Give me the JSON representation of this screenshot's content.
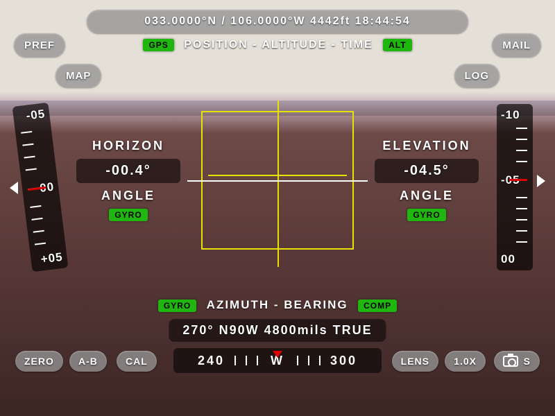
{
  "top": {
    "status": "033.0000°N / 106.0000°W   4442ft   18:44:54",
    "subtitle": "POSITION - ALTITUDE - TIME",
    "gps_chip": "GPS",
    "alt_chip": "ALT"
  },
  "buttons": {
    "pref": "PREF",
    "map": "MAP",
    "mail": "MAIL",
    "log": "LOG",
    "zero": "ZERO",
    "ab": "A-B",
    "cal": "CAL",
    "lens": "LENS",
    "zoom": "1.0X",
    "cam_suffix": "S"
  },
  "horizon": {
    "title": "HORIZON",
    "value": "-00.4°",
    "sub": "ANGLE",
    "chip": "GYRO",
    "scale_top": "-05",
    "scale_mid": "00",
    "scale_bot": "+05"
  },
  "elevation": {
    "title": "ELEVATION",
    "value": "-04.5°",
    "sub": "ANGLE",
    "chip": "GYRO",
    "scale_top": "-10",
    "scale_mid": "-05",
    "scale_bot": "00"
  },
  "azimuth": {
    "title": "AZIMUTH - BEARING",
    "gyro_chip": "GYRO",
    "comp_chip": "COMP",
    "readout": "270° N90W 4800mils TRUE",
    "compass_left": "240",
    "compass_center": "W",
    "compass_right": "300"
  }
}
